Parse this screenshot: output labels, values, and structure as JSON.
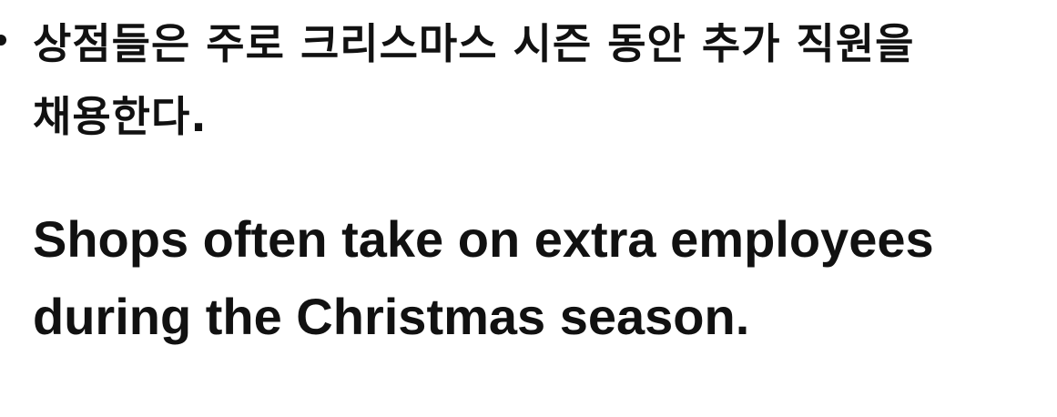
{
  "example": {
    "korean_lines": [
      "상점들은 주로 크리스마스 시즌 동안 추가 직원을",
      "채용한다."
    ],
    "english_lines": [
      "Shops often take on extra employees",
      "during the Christmas season."
    ]
  }
}
